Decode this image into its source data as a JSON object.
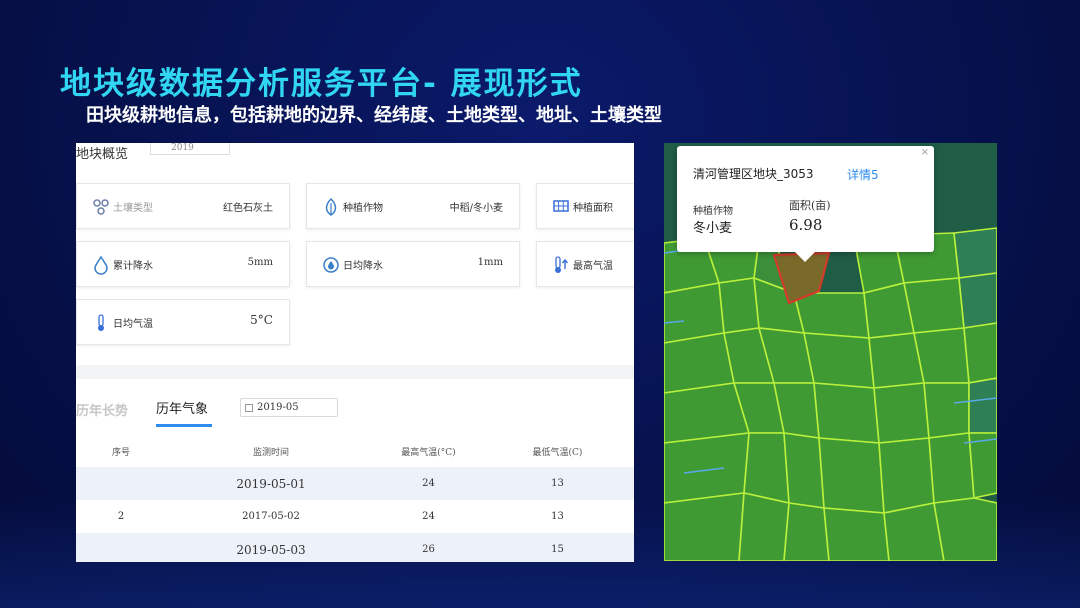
{
  "header": {
    "title": "地块级数据分析服务平台- 展现形式",
    "subtitle": "田块级耕地信息，包括耕地的边界、经纬度、土地类型、地址、土壤类型"
  },
  "overview": {
    "title": "地块概览",
    "year": "2019",
    "cards": {
      "soil_type": {
        "label": "土壤类型",
        "value": "红色石灰土",
        "icon": "soil-icon"
      },
      "crop": {
        "label": "种植作物",
        "value": "中稻/冬小麦",
        "icon": "plant-icon"
      },
      "planting_area": {
        "label": "种植面积",
        "icon": "grid-area-icon"
      },
      "cumulative_rain": {
        "label": "累计降水",
        "value": "5mm",
        "icon": "raindrop-icon"
      },
      "daily_rain": {
        "label": "日均降水",
        "value": "1mm",
        "icon": "daily-rain-icon"
      },
      "max_temp": {
        "label": "最高气温",
        "icon": "thermometer-up-icon"
      },
      "daily_temp": {
        "label": "日均气温",
        "value": "5°C",
        "icon": "thermometer-icon"
      }
    }
  },
  "history": {
    "tab_trend": "历年长势",
    "tab_weather": "历年气象",
    "date": "2019-05",
    "table": {
      "headers": [
        "序号",
        "监测时间",
        "最高气温(°C)",
        "最低气温(C)"
      ],
      "rows": [
        {
          "index": "",
          "date": "2019-05-01",
          "max": "24",
          "min": "13"
        },
        {
          "index": "2",
          "date": "2017-05-02",
          "max": "24",
          "min": "13"
        },
        {
          "index": "",
          "date": "2019-05-03",
          "max": "26",
          "min": "15"
        }
      ]
    }
  },
  "map": {
    "popup": {
      "title": "清河管理区地块_3053",
      "detail_link": "详情5",
      "close": "×",
      "crop_label": "种植作物",
      "crop_value": "冬小麦",
      "area_label": "面积(亩)",
      "area_value": "6.98"
    },
    "colors": {
      "field_fill": "#3a9a3a",
      "field_border": "#b8f03c",
      "water_border": "#5aa8e8",
      "selected": "#d43a2a"
    }
  }
}
